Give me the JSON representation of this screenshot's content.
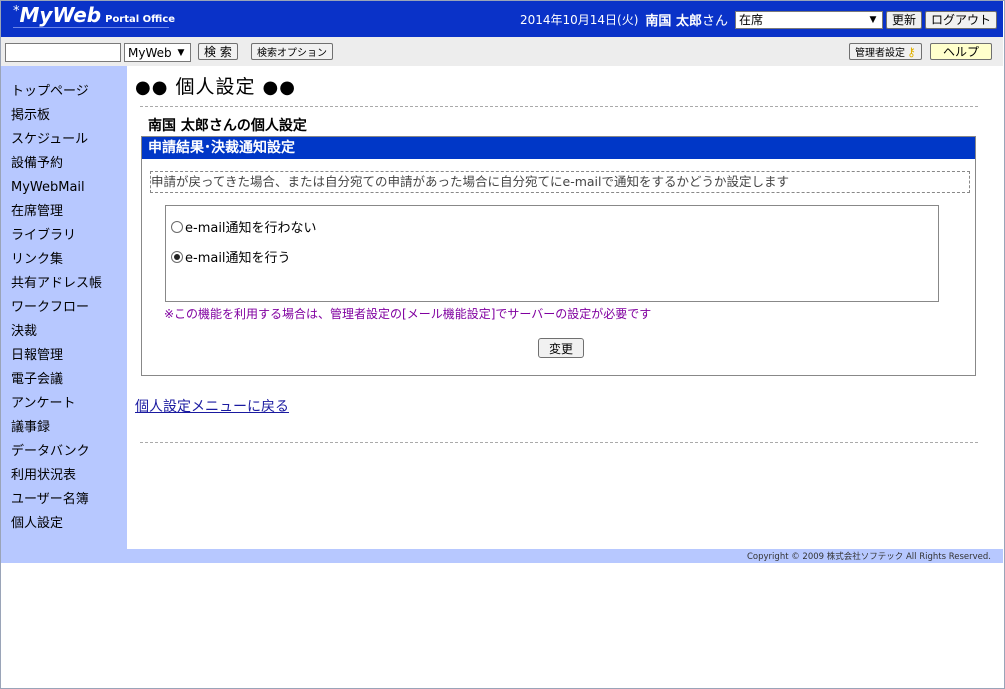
{
  "header": {
    "logo_star": "*",
    "logo_brand": "MyWeb",
    "logo_sub": "Portal Office",
    "date": "2014年10月14日(火)",
    "user_name": "南国 太郎",
    "user_suffix": "さん",
    "status_value": "在席",
    "refresh_label": "更新",
    "logout_label": "ログアウト"
  },
  "toolbar": {
    "search_value": "",
    "app_select_value": "MyWeb",
    "search_label": "検 索",
    "search_options_label": "検索オプション",
    "admin_label": "管理者設定",
    "help_label": "ヘルプ"
  },
  "sidebar": {
    "items": [
      {
        "label": "トップページ"
      },
      {
        "label": "掲示板"
      },
      {
        "label": "スケジュール"
      },
      {
        "label": "設備予約"
      },
      {
        "label": "MyWebMail"
      },
      {
        "label": "在席管理"
      },
      {
        "label": "ライブラリ"
      },
      {
        "label": "リンク集"
      },
      {
        "label": "共有アドレス帳"
      },
      {
        "label": "ワークフロー"
      },
      {
        "label": "決裁"
      },
      {
        "label": "日報管理"
      },
      {
        "label": "電子会議"
      },
      {
        "label": "アンケート"
      },
      {
        "label": "議事録"
      },
      {
        "label": "データバンク"
      },
      {
        "label": "利用状況表"
      },
      {
        "label": "ユーザー名簿"
      },
      {
        "label": "個人設定"
      }
    ]
  },
  "main": {
    "title_prefix": "●●",
    "title": "個人設定",
    "title_suffix": "●●",
    "subtitle": "南国 太郎さんの個人設定",
    "panel_title": "申請結果･決裁通知設定",
    "description": "申請が戻ってきた場合、または自分宛ての申請があった場合に自分宛てにe-mailで通知をするかどうか設定します",
    "options": [
      {
        "label": "e-mail通知を行わない",
        "selected": false
      },
      {
        "label": "e-mail通知を行う",
        "selected": true
      }
    ],
    "note": "※この機能を利用する場合は、管理者設定の[メール機能設定]でサーバーの設定が必要です",
    "change_label": "変更",
    "back_link": "個人設定メニューに戻る"
  },
  "footer": {
    "copyright": "Copyright © 2009 株式会社ソフテック All Rights Reserved."
  },
  "colors": {
    "header_bg": "#0a32c8",
    "sidebar_bg": "#b7c8ff",
    "panel_bar": "#0037c7",
    "note_text": "#8000a0",
    "link": "#1a1aa0"
  }
}
